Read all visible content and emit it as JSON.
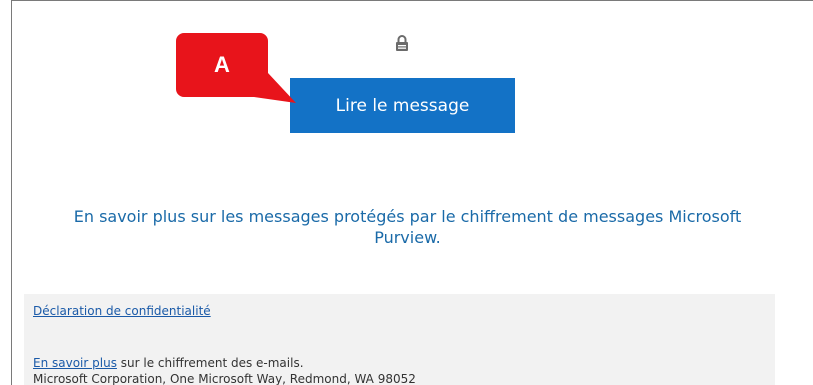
{
  "email": {
    "read_button_label": "Lire le message",
    "learn_more_text": "En savoir plus sur les messages protégés par le chiffrement de messages Microsoft Purview.",
    "lock_icon": "lock-icon"
  },
  "callout": {
    "label": "A",
    "color": "#e8141b"
  },
  "footer": {
    "privacy_link": "Déclaration de confidentialité",
    "learn_more_link": "En savoir plus",
    "learn_more_suffix": " sur le chiffrement des e-mails.",
    "address": "Microsoft Corporation, One Microsoft Way, Redmond, WA 98052"
  },
  "colors": {
    "button": "#1372c6",
    "link": "#1a6aa8",
    "footer_bg": "#f2f2f2"
  }
}
